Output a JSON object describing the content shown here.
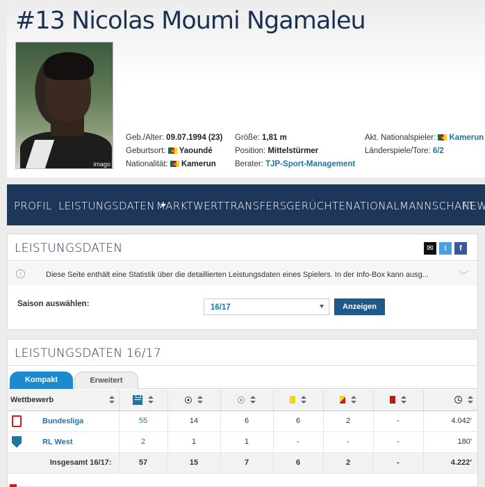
{
  "player": {
    "number": "#13",
    "first_name": "Nicolas",
    "last_name": "Moumi Ngamaleu",
    "photo_credit": "imago"
  },
  "info": {
    "birth_label": "Geb./Alter:",
    "birth_value": "09.07.1994 (23)",
    "birthplace_label": "Geburtsort:",
    "birthplace_value": "Yaoundé",
    "nationality_label": "Nationalität:",
    "nationality_value": "Kamerun",
    "height_label": "Größe:",
    "height_value": "1,81 m",
    "position_label": "Position:",
    "position_value": "Mittelstürmer",
    "agent_label": "Berater:",
    "agent_value": "TJP-Sport-Management",
    "national_player_label": "Akt. Nationalspieler:",
    "national_player_value": "Kamerun",
    "caps_label": "Länderspiele/Tore:",
    "caps_value": "6/2"
  },
  "nav": {
    "items": [
      "PROFIL",
      "LEISTUNGSDATEN",
      "MARKTWERT",
      "TRANSFERS",
      "GERÜCHTE",
      "NATIONALMANNSCHAFT",
      "NEWS"
    ]
  },
  "box1": {
    "title": "LEISTUNGSDATEN",
    "info_text": "Diese Seite enthält eine Statistik über die detaillierten Leistungsdaten eines Spielers. In der Info-Box kann ausg...",
    "season_label": "Saison auswählen:",
    "season_value": "16/17",
    "button_label": "Anzeigen"
  },
  "box2": {
    "title": "LEISTUNGSDATEN 16/17",
    "tab_active": "Kompakt",
    "tab_inactive": "Erweitert",
    "col_competition": "Wettbewerb"
  },
  "table": {
    "rows": [
      {
        "competition": "Bundesliga",
        "apps": "55",
        "goals": "14",
        "assists": "6",
        "yellow": "6",
        "yellow_red": "2",
        "red": "-",
        "minutes": "4.042'"
      },
      {
        "competition": "RL West",
        "apps": "2",
        "goals": "1",
        "assists": "1",
        "yellow": "-",
        "yellow_red": "-",
        "red": "-",
        "minutes": "180'"
      }
    ],
    "total": {
      "label": "Insgesamt 16/17:",
      "apps": "57",
      "goals": "15",
      "assists": "7",
      "yellow": "6",
      "yellow_red": "2",
      "red": "-",
      "minutes": "4.222'"
    }
  },
  "colors": {
    "nav_bg": "#1d3659",
    "accent": "#1d75a3",
    "tab_active": "#1d8ad0"
  }
}
